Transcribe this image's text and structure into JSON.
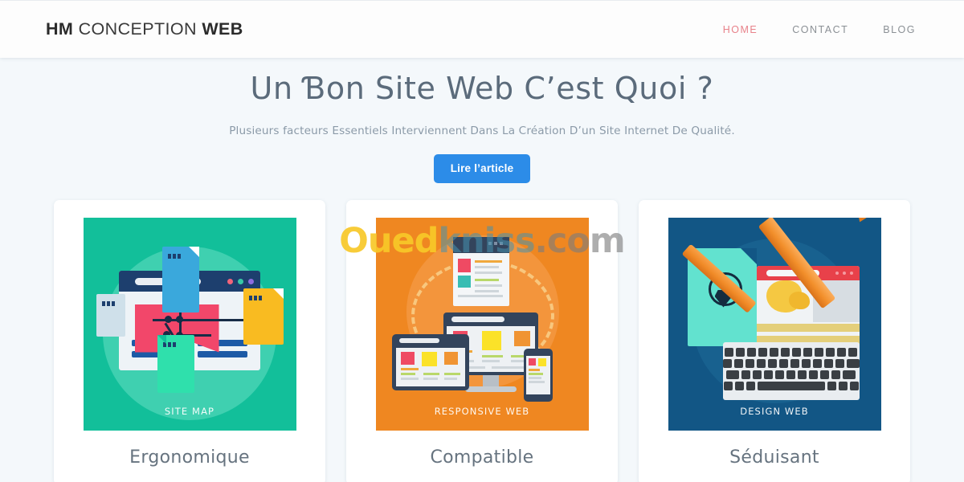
{
  "header": {
    "brand": {
      "strong_1": "HM",
      "light": " CONCEPTION ",
      "strong_2": "WEB"
    },
    "nav": [
      {
        "label": "HOME",
        "active": true
      },
      {
        "label": "CONTACT",
        "active": false
      },
      {
        "label": "BLOG",
        "active": false
      }
    ],
    "active_color": "#e8828a",
    "inactive_color": "#8b9095"
  },
  "hero": {
    "title": "Un Ɓon Site Web C’est Quoi ?",
    "subtitle": "Plusieurs facteurs Essentiels Interviennent Dans La Création D’un Site Internet De Qualité.",
    "cta_label": "Lire l’article",
    "cta_color": "#2c8ce8",
    "title_color": "#5b6b7b"
  },
  "cards": [
    {
      "title": "Ergonomique",
      "figure_caption": "SITE MAP",
      "figure_color": "#12bf9a",
      "figure_name": "sitemap-illustration"
    },
    {
      "title": "Compatible",
      "figure_caption": "RESPONSIVE WEB",
      "figure_color": "#ef8721",
      "figure_name": "responsive-web-illustration"
    },
    {
      "title": "Séduisant",
      "figure_caption": "DESIGN WEB",
      "figure_color": "#125685",
      "figure_name": "design-web-illustration"
    }
  ],
  "watermark": {
    "part_1": "Oued",
    "part_2": "kniss",
    "part_3": ".com",
    "color_1": "#f7c828",
    "color_2": "#4691af",
    "color_3": "#7d7d7d"
  },
  "page": {
    "background": "#f4f8fb"
  }
}
